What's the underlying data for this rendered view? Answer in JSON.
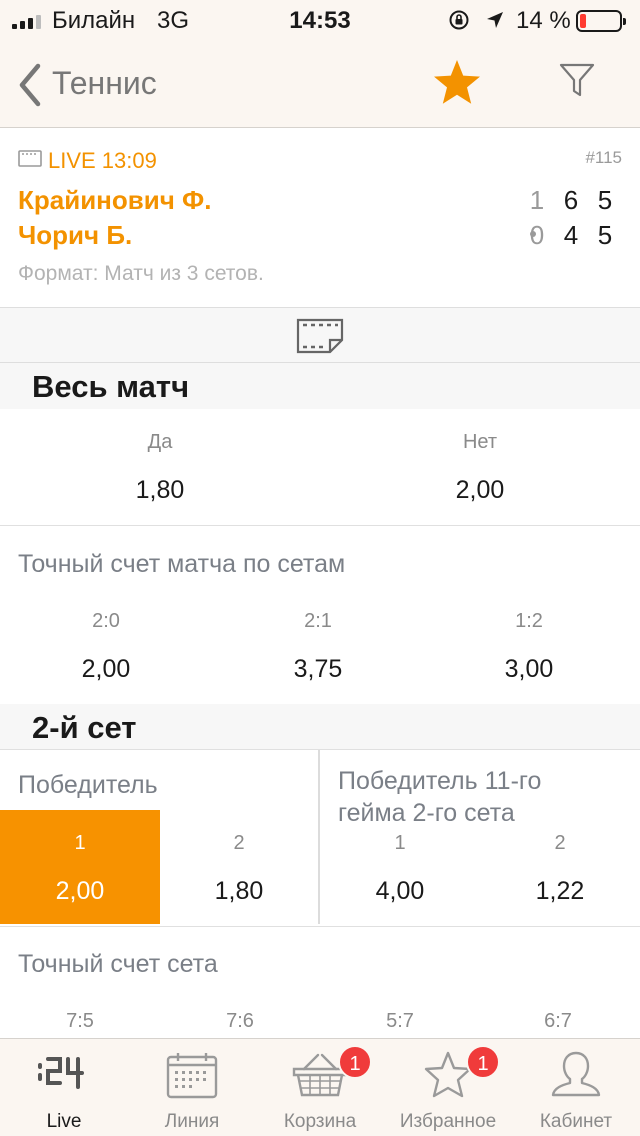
{
  "status_bar": {
    "carrier": "Билайн",
    "network": "3G",
    "time": "14:53",
    "battery_percent": "14 %",
    "battery_level": 0.14
  },
  "nav": {
    "back_label": "Теннис",
    "favorite_icon": "star-icon",
    "filter_icon": "filter-icon",
    "accent_color": "#f39200"
  },
  "match": {
    "live_label": "LIVE 13:09",
    "event_number": "#115",
    "player1": "Крайинович Ф.",
    "player2": "Чорич Б.",
    "player1_scores": [
      "1",
      "6",
      "5"
    ],
    "player2_scores": [
      "0",
      "4",
      "5"
    ],
    "format": "Формат: Матч из 3 сетов."
  },
  "sections": {
    "whole_match": "Весь матч",
    "second_set": "2-й сет"
  },
  "markets": {
    "whole_match_yes_no": {
      "outcomes": [
        {
          "label": "Да",
          "odd": "1,80"
        },
        {
          "label": "Нет",
          "odd": "2,00"
        }
      ]
    },
    "exact_score_sets": {
      "title": "Точный счет матча по сетам",
      "outcomes": [
        {
          "label": "2:0",
          "odd": "2,00"
        },
        {
          "label": "2:1",
          "odd": "3,75"
        },
        {
          "label": "1:2",
          "odd": "3,00"
        }
      ]
    },
    "set_winner": {
      "title": "Победитель",
      "outcomes": [
        {
          "label": "1",
          "odd": "2,00",
          "selected": true
        },
        {
          "label": "2",
          "odd": "1,80"
        }
      ]
    },
    "game11_winner": {
      "title_line1": "Победитель 11-го",
      "title_line2": "гейма 2-го сета",
      "outcomes": [
        {
          "label": "1",
          "odd": "4,00"
        },
        {
          "label": "2",
          "odd": "1,22"
        }
      ]
    },
    "exact_set_score": {
      "title": "Точный счет сета",
      "labels": [
        "7:5",
        "7:6",
        "5:7",
        "6:7"
      ]
    }
  },
  "tabbar": {
    "tabs": [
      {
        "label": "Live",
        "icon": "live-24-icon",
        "active": true
      },
      {
        "label": "Линия",
        "icon": "calendar-icon"
      },
      {
        "label": "Корзина",
        "icon": "basket-icon",
        "badge": "1"
      },
      {
        "label": "Избранное",
        "icon": "star-outline-icon",
        "badge": "1"
      },
      {
        "label": "Кабинет",
        "icon": "user-icon"
      }
    ]
  }
}
